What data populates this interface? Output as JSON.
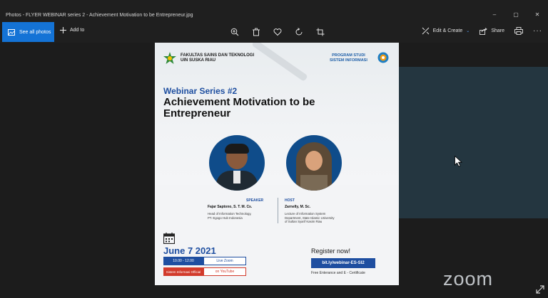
{
  "window": {
    "title": "Photos - FLYER WEBINAR series 2 - Achievement Motivation to be Entrepreneur.jpg",
    "controls": [
      "–",
      "▢",
      "✕"
    ]
  },
  "toolbar": {
    "see_all_label": "See all photos",
    "add_to_label": "Add to",
    "edit_create_label": "Edit & Create",
    "share_label": "Share",
    "icons": [
      "zoom-in-icon",
      "delete-icon",
      "favorite-icon",
      "rotate-icon",
      "crop-icon",
      "print-icon",
      "more-icon"
    ]
  },
  "flyer": {
    "institution_line1": "FAKULTAS SAINS DAN TEKNOLOGI",
    "institution_line2": "UIN SUSKA RIAU",
    "program_line1": "PROGRAM STUDI",
    "program_line2": "SISTEM INFORMASI",
    "series": "Webinar Series #2",
    "headline_line1": "Achievement Motivation to be",
    "headline_line2": "Entrepreneur",
    "speaker": {
      "role": "SPEAKER",
      "name": "Fajar Saptono, S. T. M. Cs.",
      "desc_line1": "Head of Information Technology,",
      "desc_line2": "PT. Egogo Hub Indonesia"
    },
    "host": {
      "role": "HOST",
      "name": "Zarnelly, M. Sc.",
      "desc_line1": "Lecture of Information System",
      "desc_line2": "Department, State Islamic University",
      "desc_line3": "of Sultan Syarif Kasim Riau"
    },
    "date": "June 7 2021",
    "time": "10.00 - 12.00",
    "live_zoom": "Live Zoom",
    "yt_channel": "Sistem Informasi Official",
    "on_youtube": "on YouTube",
    "register": "Register now!",
    "link": "bit.ly/webinar-ES-SI2",
    "free": "Free Enterance and E - Certificate"
  },
  "overlay": {
    "watermark": "zoom"
  },
  "colors": {
    "accent": "#1473d6",
    "flyer_blue": "#1e4ea0",
    "flyer_red": "#d23b2c"
  }
}
